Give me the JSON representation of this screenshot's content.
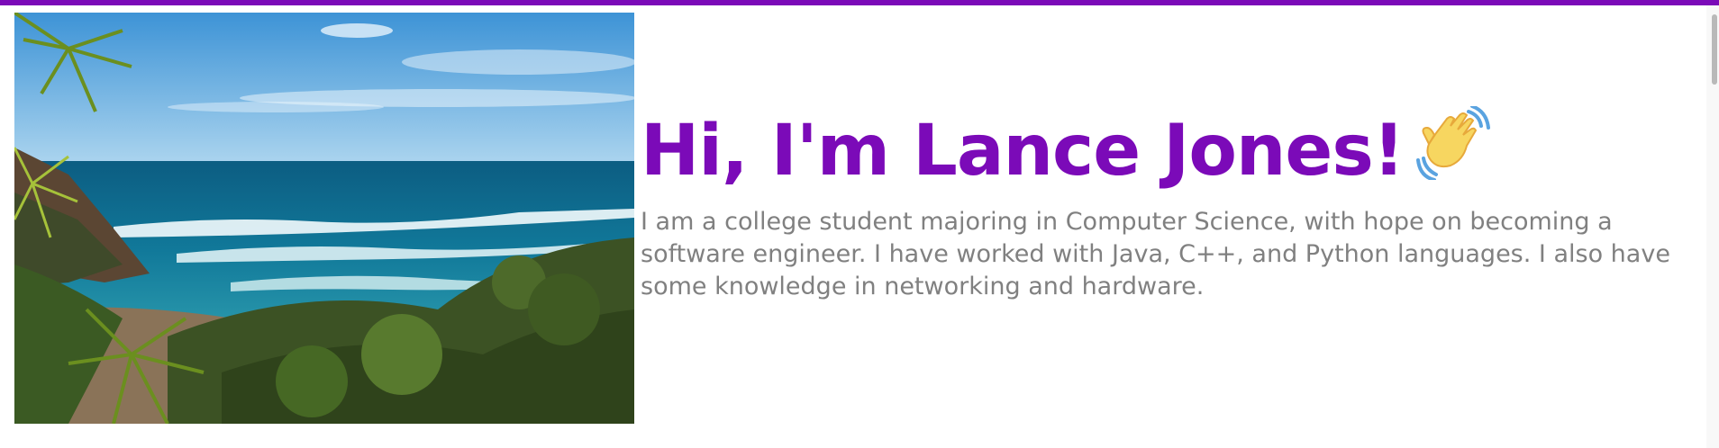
{
  "theme": {
    "accent": "#7b0ab8",
    "bio_color": "#808080"
  },
  "hero": {
    "image_icon": "beach-landscape-image",
    "heading": "Hi, I'm Lance Jones!",
    "heading_icon": "waving-hand-icon",
    "bio": "I am a college student majoring in Computer Science, with hope on becoming a software engineer. I have worked with Java, C++, and Python languages. I also have some knowledge in networking and hardware."
  }
}
